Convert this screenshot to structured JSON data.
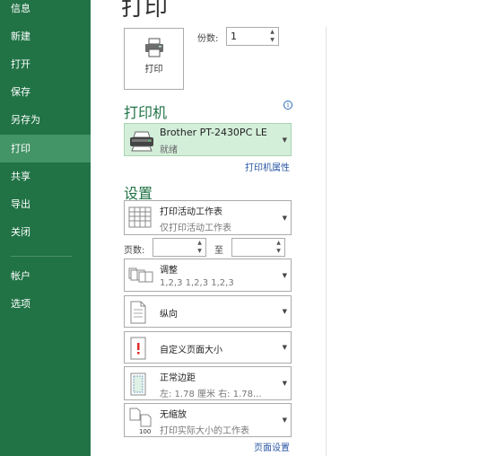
{
  "sidebar": {
    "items": [
      {
        "label": "信息"
      },
      {
        "label": "新建"
      },
      {
        "label": "打开"
      },
      {
        "label": "保存"
      },
      {
        "label": "另存为"
      },
      {
        "label": "打印"
      },
      {
        "label": "共享"
      },
      {
        "label": "导出"
      },
      {
        "label": "关闭"
      },
      {
        "label": "帐户"
      },
      {
        "label": "选项"
      }
    ],
    "active_index": 5,
    "bg_color": "#217346",
    "active_color": "#439467"
  },
  "page": {
    "title": "打印"
  },
  "print_button": {
    "label": "打印",
    "icon": "printer-icon"
  },
  "copies": {
    "label": "份数:",
    "value": "1"
  },
  "printer": {
    "section_title": "打印机",
    "name": "Brother PT-2430PC LE",
    "status": "就绪",
    "properties_link": "打印机属性",
    "info_icon": "i"
  },
  "settings": {
    "section_title": "设置",
    "print_what": {
      "title": "打印活动工作表",
      "subtitle": "仅打印活动工作表"
    },
    "pages": {
      "label": "页数:",
      "to_label": "至",
      "from_value": "",
      "to_value": ""
    },
    "collate": {
      "title": "调整",
      "subtitle": "1,2,3    1,2,3    1,2,3"
    },
    "orientation": {
      "title": "纵向"
    },
    "paper_size": {
      "title": "自定义页面大小"
    },
    "margins": {
      "title": "正常边距",
      "subtitle": "左: 1.78 厘米    右: 1.78..."
    },
    "scaling": {
      "title": "无缩放",
      "subtitle": "打印实际大小的工作表"
    },
    "page_setup_link": "页面设置"
  },
  "colors": {
    "accent": "#217346",
    "link": "#2b57a5",
    "printer_highlight": "#d3eed9"
  }
}
